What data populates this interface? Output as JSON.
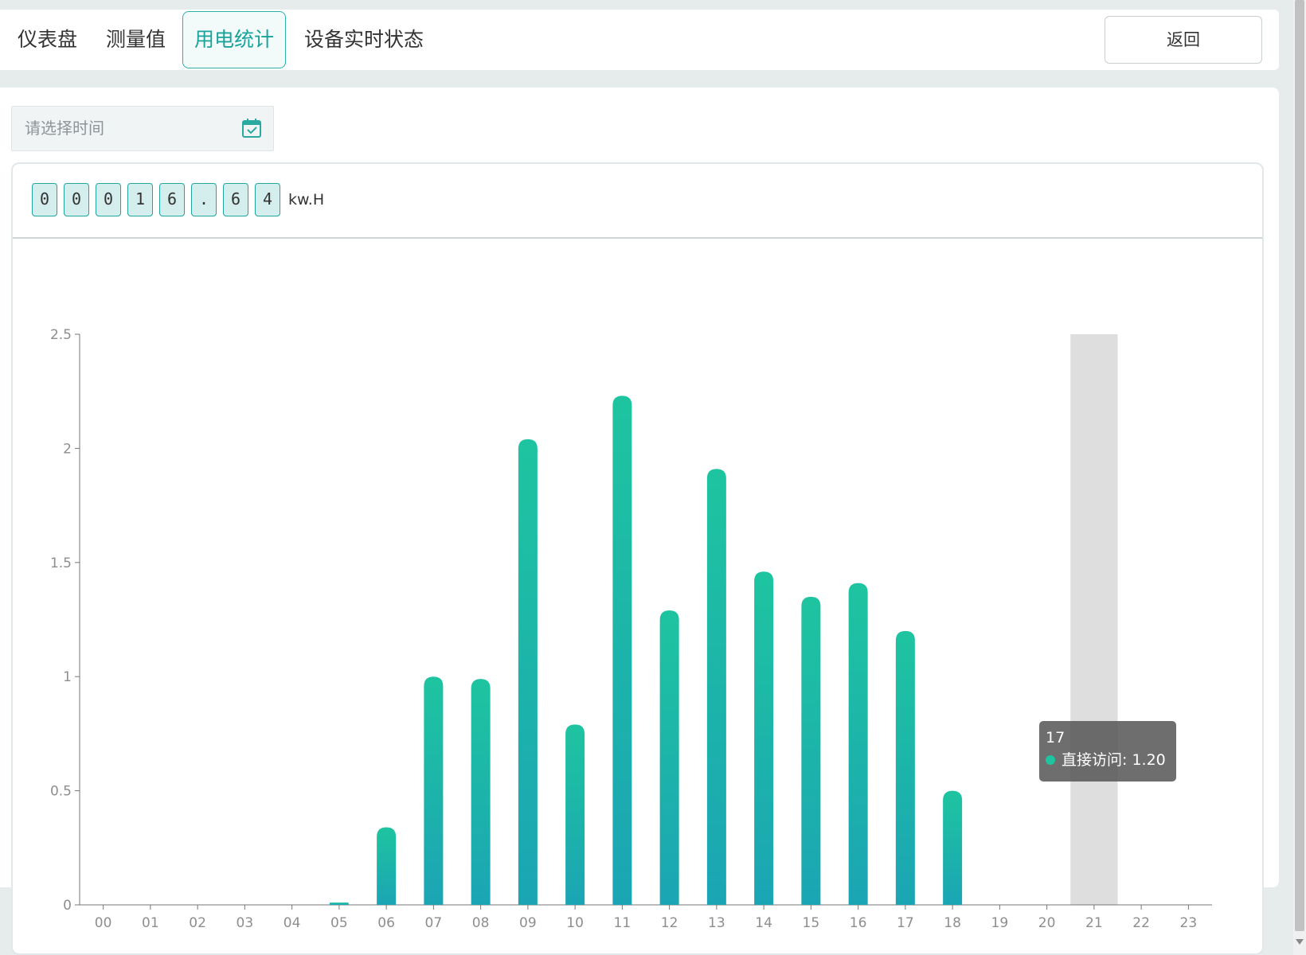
{
  "tabs": [
    {
      "label": "仪表盘"
    },
    {
      "label": "测量值"
    },
    {
      "label": "用电统计"
    },
    {
      "label": "设备实时状态"
    }
  ],
  "back_label": "返回",
  "date_picker": {
    "placeholder": "请选择时间",
    "icon": "calendar-check-icon"
  },
  "counter": {
    "digits": [
      "0",
      "0",
      "0",
      "1",
      "6",
      ".",
      "6",
      "4"
    ],
    "unit": "kw.H"
  },
  "colors": {
    "accent": "#1aa39b",
    "bar_top": "#1ec4a0",
    "bar_bottom": "#1ba5b4",
    "highlight": "#dedede"
  },
  "chart_data": {
    "type": "bar",
    "categories": [
      "00",
      "01",
      "02",
      "03",
      "04",
      "05",
      "06",
      "07",
      "08",
      "09",
      "10",
      "11",
      "12",
      "13",
      "14",
      "15",
      "16",
      "17",
      "18",
      "19",
      "20",
      "21",
      "22",
      "23"
    ],
    "series": [
      {
        "name": "直接访问",
        "values": [
          0,
          0,
          0,
          0,
          0,
          0.01,
          0.34,
          1.0,
          0.99,
          2.04,
          0.79,
          2.23,
          1.29,
          1.91,
          1.46,
          1.35,
          1.41,
          1.2,
          0.5,
          0,
          0,
          0,
          0,
          0
        ]
      }
    ],
    "ylim": [
      0,
      2.5
    ],
    "yticks": [
      0,
      0.5,
      1,
      1.5,
      2,
      2.5
    ],
    "grid": false,
    "highlighted_category": "21",
    "tooltip": {
      "title": "17",
      "label": "直接访问: 1.20"
    }
  }
}
